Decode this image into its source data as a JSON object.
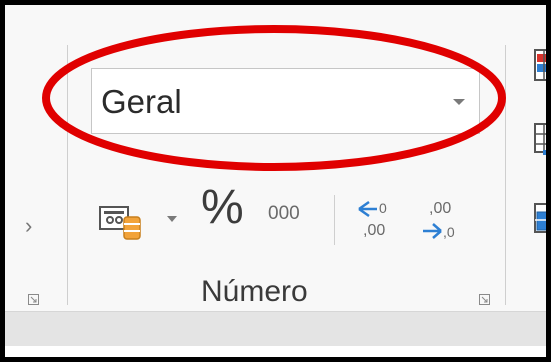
{
  "number_group": {
    "format_value": "Geral",
    "format_dropdown_icon": "chevron-down-icon",
    "accounting_icon": "accounting-format-icon",
    "percent_label": "%",
    "thousands_label": "000",
    "increase_decimal_top": "←0",
    "increase_decimal_bottom": ",00",
    "decrease_decimal_top": ",00",
    "decrease_decimal_bottom": "→,0",
    "group_label": "Número"
  },
  "annotation": {
    "ellipse_color": "#e00000"
  },
  "colors": {
    "ribbon_bg": "#f8f8f8",
    "separator": "#cfcfcf",
    "accent_blue": "#2d7fd3",
    "accent_orange": "#f2a33a",
    "accent_red": "#d9322b"
  }
}
